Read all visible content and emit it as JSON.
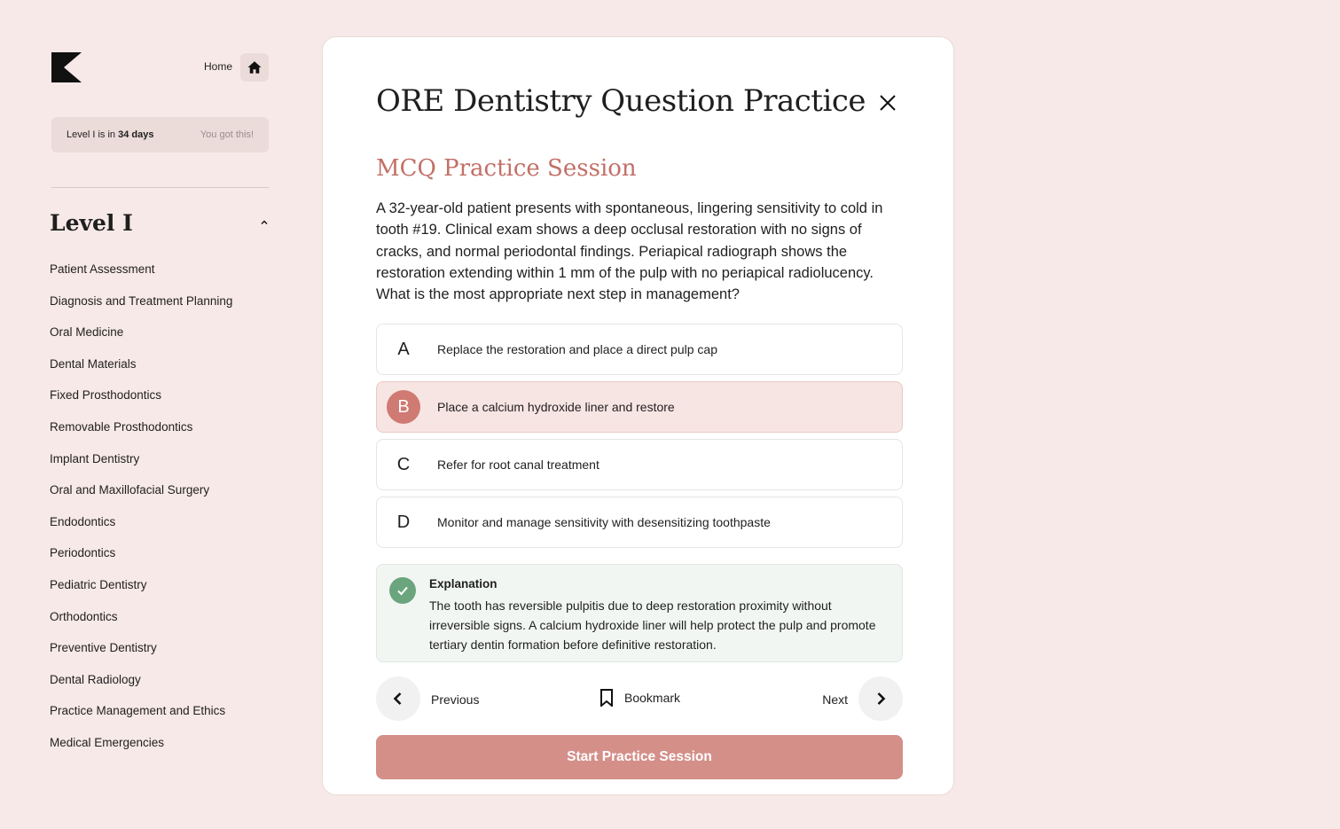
{
  "sidebar": {
    "home_label": "Home",
    "countdown": {
      "prefix": "Level I is in",
      "days": "34 days",
      "encouragement": "You got this!"
    },
    "level_title": "Level I",
    "topics": [
      "Patient Assessment",
      "Diagnosis and Treatment Planning",
      "Oral Medicine",
      "Dental Materials",
      "Fixed Prosthodontics",
      "Removable Prosthodontics",
      "Implant Dentistry",
      "Oral and Maxillofacial Surgery",
      "Endodontics",
      "Periodontics",
      "Pediatric Dentistry",
      "Orthodontics",
      "Preventive Dentistry",
      "Dental Radiology",
      "Practice Management and Ethics",
      "Medical Emergencies"
    ]
  },
  "card": {
    "title": "ORE Dentistry Question Practice",
    "session_title": "MCQ Practice Session",
    "question": "A 32-year-old patient presents with spontaneous, lingering sensitivity to cold in tooth #19. Clinical exam shows a deep occlusal restoration with no signs of cracks, and normal periodontal findings. Periapical radiograph shows the restoration extending within 1 mm of the pulp with no periapical radiolucency. What is the most appropriate next step in management?",
    "options": [
      {
        "letter": "A",
        "text": "Replace the restoration and place a direct pulp cap"
      },
      {
        "letter": "B",
        "text": "Place a calcium hydroxide liner and restore"
      },
      {
        "letter": "C",
        "text": "Refer for root canal treatment"
      },
      {
        "letter": "D",
        "text": "Monitor and manage sensitivity with desensitizing toothpaste"
      }
    ],
    "selected_option": "B",
    "explanation": {
      "title": "Explanation",
      "text": "The tooth has reversible pulpitis due to deep restoration proximity without irreversible signs. A calcium hydroxide liner will help protect the pulp and promote tertiary dentin formation before definitive restoration."
    },
    "nav": {
      "previous_label": "Previous",
      "bookmark_label": "Bookmark",
      "next_label": "Next"
    },
    "start_button_label": "Start Practice Session"
  },
  "colors": {
    "background": "#f7e9e7",
    "accent": "#cf7a72",
    "accent_button": "#d48f89",
    "success": "#6aa57e"
  },
  "icons": [
    "logo-icon",
    "home-icon",
    "chevron-up-icon",
    "close-icon",
    "check-icon",
    "chevron-left-icon",
    "bookmark-icon",
    "chevron-right-icon"
  ]
}
